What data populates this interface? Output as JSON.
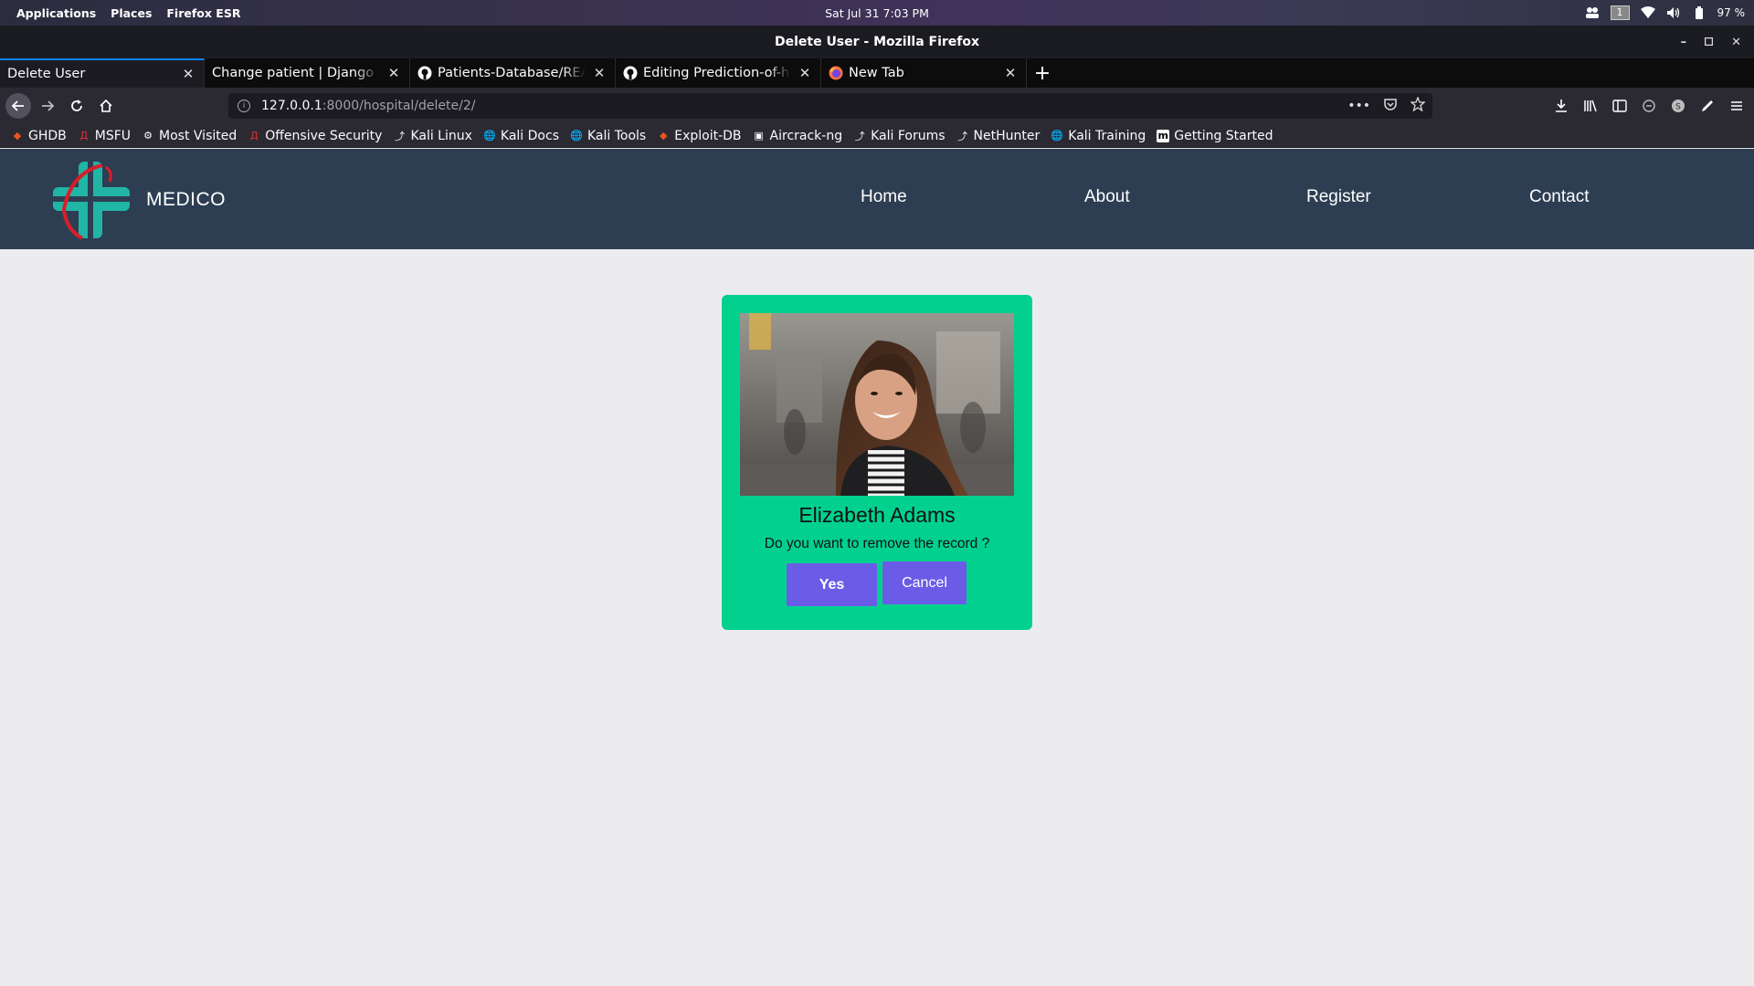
{
  "system": {
    "menu": [
      "Applications",
      "Places",
      "Firefox ESR"
    ],
    "clock": "Sat Jul 31   7:03 PM",
    "workspace": "1",
    "battery": "97 %"
  },
  "window": {
    "title": "Delete User - Mozilla Firefox"
  },
  "tabs": [
    {
      "label": "Delete User",
      "active": true
    },
    {
      "label": "Change patient | Django site admin"
    },
    {
      "label": "Patients-Database/README.md"
    },
    {
      "label": "Editing Prediction-of-heart"
    },
    {
      "label": "New Tab"
    }
  ],
  "urlbar": {
    "host": "127.0.0.1",
    "rest": ":8000/hospital/delete/2/",
    "actions": "•••"
  },
  "bookmarks": [
    "GHDB",
    "MSFU",
    "Most Visited",
    "Offensive Security",
    "Kali Linux",
    "Kali Docs",
    "Kali Tools",
    "Exploit-DB",
    "Aircrack-ng",
    "Kali Forums",
    "NetHunter",
    "Kali Training",
    "Getting Started"
  ],
  "site": {
    "brand": "MEDICO",
    "nav": [
      "Home",
      "About",
      "Register",
      "Contact"
    ]
  },
  "card": {
    "name": "Elizabeth Adams",
    "question": "Do you want to remove the record ?",
    "yes_label": "Yes",
    "cancel_label": "Cancel"
  },
  "colors": {
    "header": "#2d3e52",
    "card": "#02d18e",
    "button": "#6b5ce8",
    "page": "#ececef"
  }
}
